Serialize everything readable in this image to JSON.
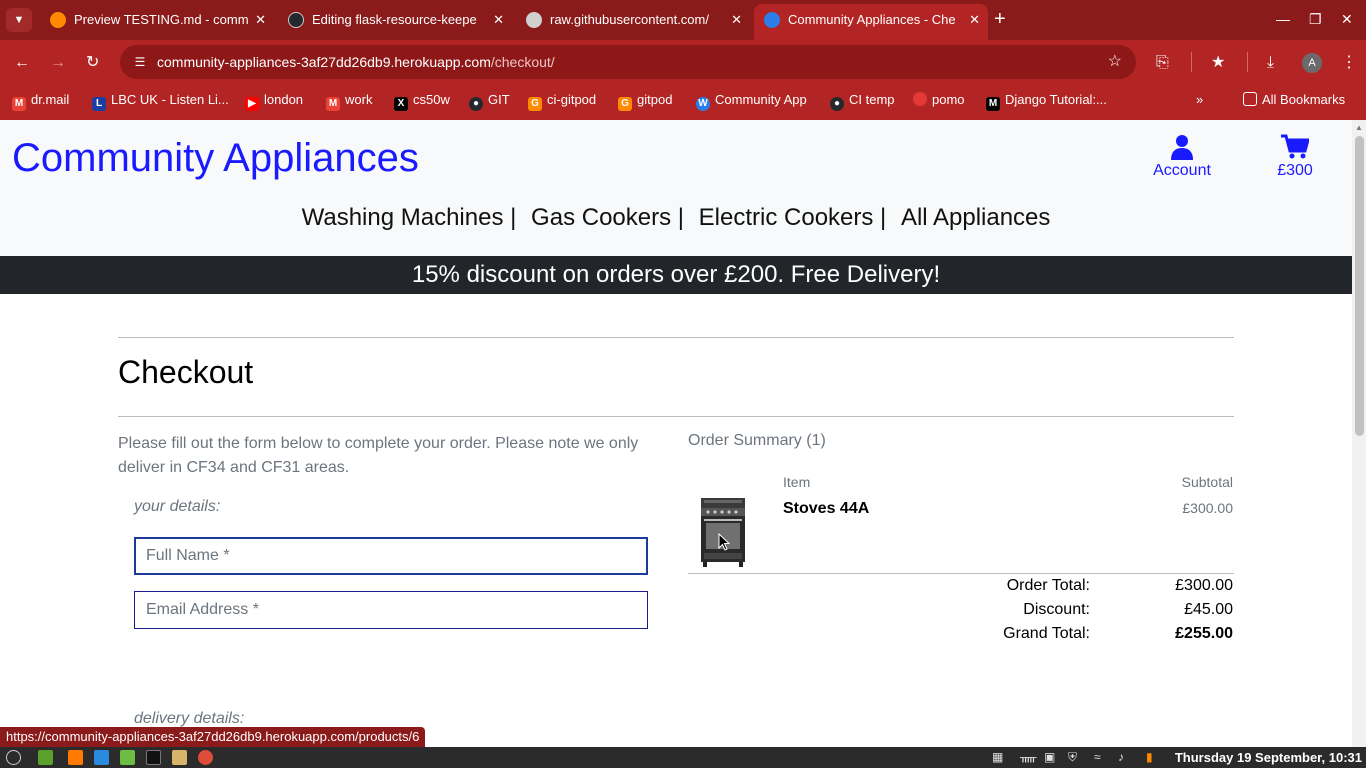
{
  "browser": {
    "tabs": [
      {
        "label": "Preview TESTING.md - comm",
        "icon": "gitpod-icon",
        "active": false
      },
      {
        "label": "Editing flask-resource-keepe",
        "icon": "github-icon",
        "active": false
      },
      {
        "label": "raw.githubusercontent.com/",
        "icon": "globe-icon",
        "active": false
      },
      {
        "label": "Community Appliances - Che",
        "icon": "wca-icon",
        "active": true
      }
    ],
    "url_host": "community-appliances-3af27dd26db9.herokuapp.com",
    "url_path": "/checkout/",
    "profile_initial": "A",
    "bookmarks": [
      {
        "label": "dr.mail",
        "icon": "gmail-icon"
      },
      {
        "label": "LBC UK - Listen Li...",
        "icon": "lbc-icon"
      },
      {
        "label": "london",
        "icon": "youtube-icon"
      },
      {
        "label": "work",
        "icon": "gmail-icon"
      },
      {
        "label": "cs50w",
        "icon": "x-icon"
      },
      {
        "label": "GIT",
        "icon": "github-icon"
      },
      {
        "label": "ci-gitpod",
        "icon": "gitpod-icon"
      },
      {
        "label": "gitpod",
        "icon": "gitpod-icon"
      },
      {
        "label": "Community App",
        "icon": "wca-icon"
      },
      {
        "label": "CI temp",
        "icon": "github-icon"
      },
      {
        "label": "pomo",
        "icon": "tomato-icon"
      },
      {
        "label": "Django Tutorial:...",
        "icon": "mdn-icon"
      }
    ],
    "all_bookmarks_label": "All Bookmarks",
    "status_url": "https://community-appliances-3af27dd26db9.herokuapp.com/products/6"
  },
  "site": {
    "brand": "Community Appliances",
    "account_label": "Account",
    "cart_label": "£300",
    "nav": [
      "Washing Machines |",
      "Gas Cookers |",
      "Electric Cookers |",
      "All Appliances"
    ],
    "banner": "15% discount on orders over £200. Free Delivery!"
  },
  "checkout": {
    "title": "Checkout",
    "intro": "Please fill out the form below to complete your order. Please note we only deliver in CF34 and CF31 areas.",
    "your_details_legend": "your details:",
    "full_name_placeholder": "Full Name *",
    "email_placeholder": "Email Address *",
    "delivery_details_legend": "delivery details:"
  },
  "summary": {
    "title": "Order Summary (1)",
    "item_header": "Item",
    "subtotal_header": "Subtotal",
    "items": [
      {
        "name": "Stoves 44A",
        "subtotal": "£300.00"
      }
    ],
    "order_total_label": "Order Total:",
    "order_total": "£300.00",
    "discount_label": "Discount:",
    "discount": "£45.00",
    "grand_total_label": "Grand Total:",
    "grand_total": "£255.00"
  },
  "os": {
    "clock": "Thursday 19 September, 10:31"
  },
  "colors": {
    "chrome_dark": "#8b1a1a",
    "chrome": "#b32424",
    "brand_blue": "#1a1aff",
    "banner_bg": "#222529"
  }
}
